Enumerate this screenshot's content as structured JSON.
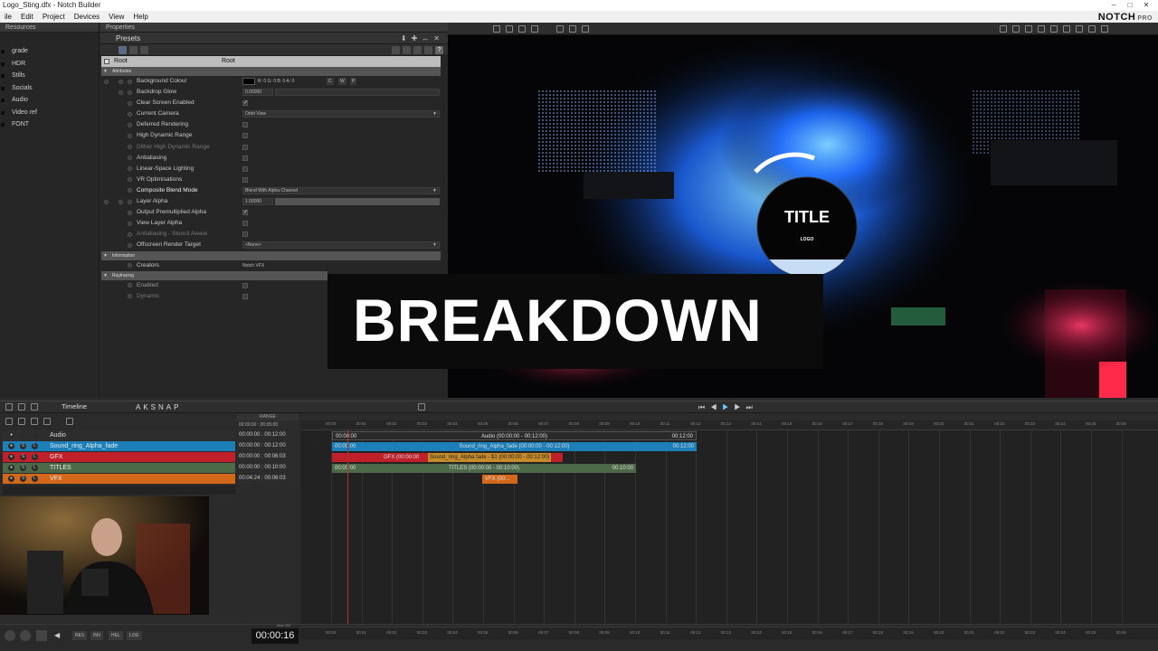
{
  "window": {
    "title": "Logo_Sting.dfx - Notch Builder",
    "controls": [
      "–",
      "□",
      "✕"
    ]
  },
  "menu": [
    "ile",
    "Edit",
    "Project",
    "Devices",
    "View",
    "Help"
  ],
  "brand": {
    "name": "NOTCH",
    "edition": "PRO"
  },
  "resources": {
    "title": "Resources",
    "items": [
      "grade",
      "HDR",
      "Stills",
      "Socials",
      "Audio",
      "Video ref",
      "FONT"
    ]
  },
  "properties": {
    "title": "Properties",
    "presets_label": "Presets",
    "root": {
      "name": "Root",
      "value": "Root"
    },
    "sections": {
      "attributes": "Attributes",
      "information": "Information",
      "raytracing": "Raytracing"
    },
    "rows": [
      {
        "label": "Background Colour",
        "value": "R: 0 G: 0 B: 0 A: 0"
      },
      {
        "label": "Backdrop Glow",
        "value": "0.00000"
      },
      {
        "label": "Clear Screen Enabled",
        "check": "✓"
      },
      {
        "label": "Current Camera",
        "value": "Orbit View"
      },
      {
        "label": "Deferred Rendering"
      },
      {
        "label": "High Dynamic Range"
      },
      {
        "label": "Dither High Dynamic Range"
      },
      {
        "label": "Antialiasing"
      },
      {
        "label": "Linear-Space Lighting"
      },
      {
        "label": "VR Optimisations"
      },
      {
        "label": "Composite Blend Mode",
        "value": "Blend With Alpha Channel"
      },
      {
        "label": "Layer Alpha",
        "value": "1.00000"
      },
      {
        "label": "Output Premultiplied Alpha",
        "check": "✓"
      },
      {
        "label": "View Layer Alpha"
      },
      {
        "label": "Antialiasing - Stencil Aware"
      },
      {
        "label": "Offscreen Render Target",
        "value": "<None>"
      }
    ],
    "creators": {
      "label": "Creators",
      "value": "Notch VFX"
    },
    "raytracing_rows": [
      {
        "label": "Enabled"
      },
      {
        "label": "Dynamic"
      }
    ],
    "colour_buttons": [
      "C",
      "W",
      "P"
    ]
  },
  "viewport": {
    "title_text": "TITLE",
    "logo_text": "LOGO",
    "overlay": "BREAKDOWN",
    "colors": {
      "glow": "#2a7cff",
      "hot": "#ff2a4a",
      "bg": "#050507"
    }
  },
  "timeline": {
    "label": "Timeline",
    "range_label": "RANGE",
    "range_start": "00:00:00",
    "range_end": "00:05:00",
    "toolbar_letters": [
      "AK",
      "S",
      "N",
      "A",
      "P"
    ],
    "ruler_ticks": [
      "00:00",
      "00:01",
      "00:02",
      "00:03",
      "00:04",
      "00:05",
      "00:06",
      "00:07",
      "00:08",
      "00:09",
      "00:10",
      "00:11",
      "00:12",
      "00:13",
      "00:14",
      "00:15",
      "00:16",
      "00:17",
      "00:18",
      "00:19",
      "00:20",
      "00:21",
      "00:22",
      "00:23",
      "00:24",
      "00:25",
      "00:26"
    ],
    "tracks": [
      {
        "name": "Audio",
        "start": "00:00:00",
        "end": "00:12:00",
        "color": "#2d2d2d"
      },
      {
        "name": "Sound_ring_Alpha_fade",
        "start": "00:00:00",
        "end": "00:12:00",
        "color": "#1c7fb8"
      },
      {
        "name": "GFX",
        "start": "00:00:00",
        "end": "00:06:03",
        "color": "#c0202a"
      },
      {
        "name": "TITLES",
        "start": "00:00:00",
        "end": "00:10:00",
        "color": "#4d6a48"
      },
      {
        "name": "VFX",
        "start": "00:04:24",
        "end": "00:06:03",
        "color": "#d4681a"
      }
    ],
    "clips": {
      "audio": {
        "left": "00:00:00",
        "center": "Audio   (00:00:00  -  00:12:00)",
        "right": "00:12:00"
      },
      "sound": {
        "left": "00:00:00",
        "center": "Sound_ring_Alpha_fade   (00:00:00  -  00:12:00)",
        "right": "00:12:00"
      },
      "gfx": {
        "label": "GFX   (00:00:00",
        "sub": "Sound_ring_Alpha fade - $1 (00:00:00 - 00:12:00)"
      },
      "titles": {
        "left": "00:00:00",
        "center": "TITLES   (00:00:00  -  00:10:00)",
        "right": "00:10:00"
      },
      "vfx": {
        "label": "VFX   (00:..."
      }
    },
    "timecode": "00:00:16",
    "bottom_buttons": [
      "RES",
      "INV",
      "HEL",
      "LOG"
    ],
    "max_label": "Max 000"
  },
  "tabs_right": [
    "Audio",
    "Sound_ring_Alpha_...",
    "GFX",
    "TITLES",
    "VFX"
  ]
}
